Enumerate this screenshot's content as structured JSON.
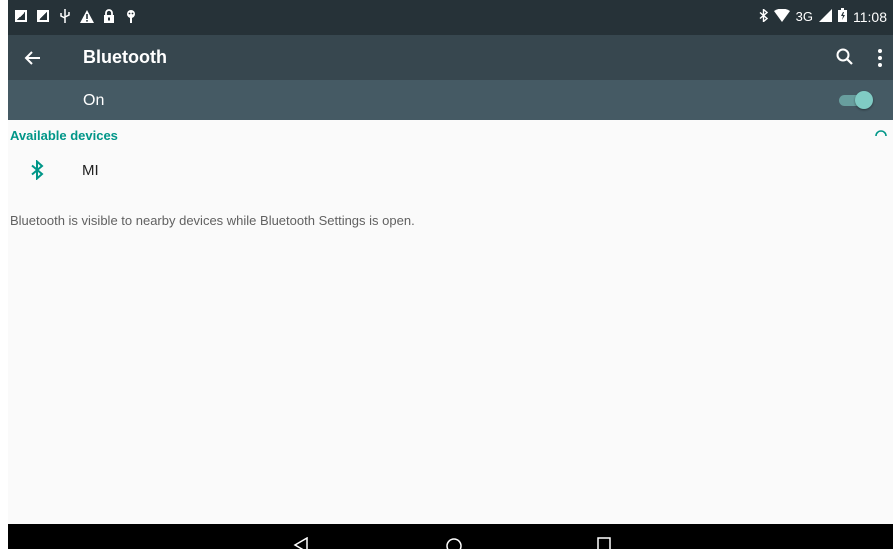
{
  "status_bar": {
    "left_icons": [
      "image-notification-icon",
      "image-notification-icon",
      "usb-icon",
      "warning-icon",
      "lock-icon",
      "android-debug-icon"
    ],
    "right_icons": [
      "bluetooth-icon",
      "wifi-icon",
      "signal-icon",
      "battery-icon"
    ],
    "network": "3G",
    "time": "11:08"
  },
  "app_bar": {
    "title": "Bluetooth",
    "actions": [
      "search-icon",
      "more-vert-icon"
    ]
  },
  "bluetooth_switch": {
    "label": "On",
    "state": "on"
  },
  "available_devices": {
    "title": "Available devices",
    "devices": [
      {
        "name": "MI",
        "icon": "bluetooth-icon"
      }
    ]
  },
  "visibility_note": "Bluetooth is visible to nearby devices while Bluetooth Settings is open.",
  "colors": {
    "status_bar": "#263238",
    "app_bar": "#37474f",
    "switch_bar": "#455a64",
    "accent": "#009688",
    "toggle": "#80cbc4"
  },
  "nav_bar": {
    "buttons": [
      "back-icon",
      "home-icon",
      "recents-icon"
    ]
  }
}
